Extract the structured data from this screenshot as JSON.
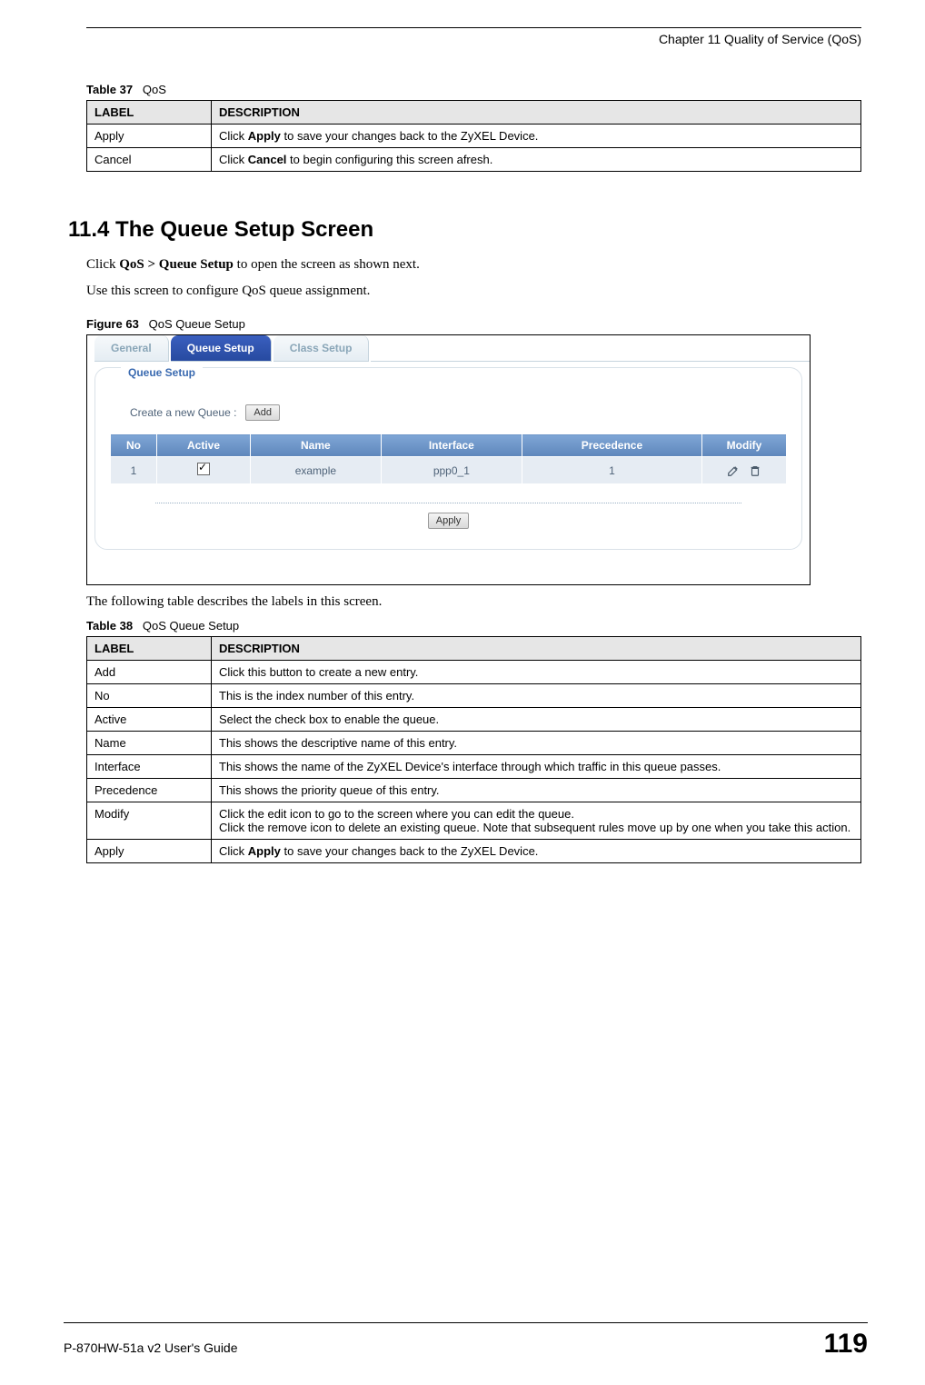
{
  "header": {
    "chapter": "Chapter 11 Quality of Service (QoS)"
  },
  "table37": {
    "caption_prefix": "Table 37",
    "caption_title": "QoS",
    "head_label": "LABEL",
    "head_desc": "DESCRIPTION",
    "rows": [
      {
        "label": "Apply",
        "desc_pre": "Click ",
        "desc_bold": "Apply",
        "desc_post": " to save your changes back to the ZyXEL Device."
      },
      {
        "label": "Cancel",
        "desc_pre": "Click ",
        "desc_bold": "Cancel",
        "desc_post": " to begin configuring this screen afresh."
      }
    ]
  },
  "section": {
    "number_title": "11.4  The Queue Setup Screen",
    "p1_pre": "Click ",
    "p1_bold": "QoS > Queue Setup",
    "p1_post": " to open the screen as shown next.",
    "p2": "Use this screen to configure QoS queue assignment."
  },
  "figure63": {
    "caption_prefix": "Figure 63",
    "caption_title": "QoS Queue Setup"
  },
  "screenshot": {
    "tabs": {
      "general": "General",
      "queue_setup": "Queue Setup",
      "class_setup": "Class Setup"
    },
    "panel_title": "Queue Setup",
    "create_label": "Create a new Queue :",
    "add_button": "Add",
    "table": {
      "head": {
        "no": "No",
        "active": "Active",
        "name": "Name",
        "interface": "Interface",
        "precedence": "Precedence",
        "modify": "Modify"
      },
      "row1": {
        "no": "1",
        "active_checked": true,
        "name": "example",
        "interface": "ppp0_1",
        "precedence": "1"
      }
    },
    "apply_button": "Apply"
  },
  "post_figure_text": "The following table describes the labels in this screen.",
  "table38": {
    "caption_prefix": "Table 38",
    "caption_title": "QoS Queue Setup",
    "head_label": "LABEL",
    "head_desc": "DESCRIPTION",
    "rows": {
      "add": {
        "label": "Add",
        "desc": "Click this button to create a new entry."
      },
      "no": {
        "label": "No",
        "desc": "This is the index number of this entry."
      },
      "active": {
        "label": "Active",
        "desc": "Select the check box to enable the queue."
      },
      "name": {
        "label": "Name",
        "desc": "This shows the descriptive name of this entry."
      },
      "interface": {
        "label": "Interface",
        "desc": "This shows the name of the ZyXEL Device's interface through which traffic in this queue passes."
      },
      "precedence": {
        "label": "Precedence",
        "desc": "This shows the priority queue of this entry."
      },
      "modify": {
        "label": "Modify",
        "desc_line1": "Click the edit icon to go to the screen where you can edit the queue.",
        "desc_line2": "Click the remove icon to delete an existing queue. Note that subsequent rules move up by one when you take this action."
      },
      "apply": {
        "label": "Apply",
        "desc_pre": "Click ",
        "desc_bold": "Apply",
        "desc_post": " to save your changes back to the ZyXEL Device."
      }
    }
  },
  "footer": {
    "guide": "P-870HW-51a v2 User's Guide",
    "page": "119"
  }
}
